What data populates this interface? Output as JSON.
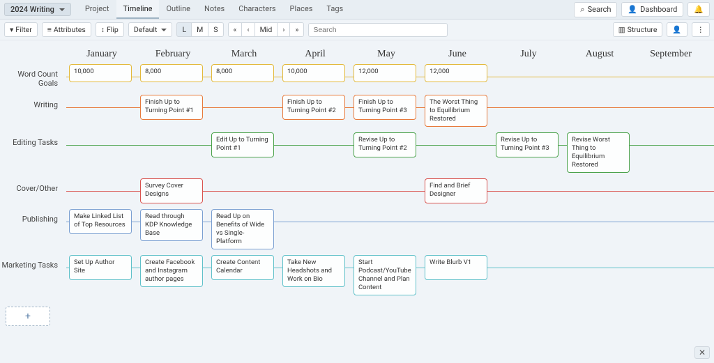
{
  "colors": {
    "gold": "#e2b93b",
    "orange": "#e77a3c",
    "green": "#4aa24a",
    "red": "#d9534f",
    "blue": "#7a9fd1",
    "teal": "#5fc0c9"
  },
  "project_name": "2024 Writing",
  "nav": {
    "tabs": [
      {
        "label": "Project"
      },
      {
        "label": "Timeline",
        "active": true
      },
      {
        "label": "Outline"
      },
      {
        "label": "Notes"
      },
      {
        "label": "Characters"
      },
      {
        "label": "Places"
      },
      {
        "label": "Tags"
      }
    ],
    "search_btn": "Search",
    "dashboard_btn": "Dashboard"
  },
  "toolbar": {
    "filter": "Filter",
    "attributes": "Attributes",
    "flip": "Flip",
    "default": "Default",
    "size_L": "L",
    "size_M": "M",
    "size_S": "S",
    "mid_label": "Mid",
    "search_placeholder": "Search",
    "structure": "Structure"
  },
  "months": [
    "January",
    "February",
    "March",
    "April",
    "May",
    "June",
    "July",
    "August",
    "September"
  ],
  "rows": [
    {
      "label": "Word Count Goals",
      "color": "gold",
      "thin": true,
      "cards": [
        {
          "col": 0,
          "text": "10,000"
        },
        {
          "col": 1,
          "text": "8,000"
        },
        {
          "col": 2,
          "text": "8,000"
        },
        {
          "col": 3,
          "text": "10,000"
        },
        {
          "col": 4,
          "text": "12,000"
        },
        {
          "col": 5,
          "text": "12,000"
        }
      ]
    },
    {
      "label": "Writing",
      "color": "orange",
      "cards": [
        {
          "col": 1,
          "text": "Finish Up to Turning Point #1"
        },
        {
          "col": 3,
          "text": "Finish Up to Turning Point #2"
        },
        {
          "col": 4,
          "text": "Finish Up to Turning Point #3"
        },
        {
          "col": 5,
          "text": "The Worst Thing to Equilibrium Restored"
        }
      ]
    },
    {
      "label": "Editing Tasks",
      "color": "green",
      "cards": [
        {
          "col": 2,
          "text": "Edit Up to Turning Point #1"
        },
        {
          "col": 4,
          "text": "Revise Up to Turning Point #2"
        },
        {
          "col": 6,
          "text": "Revise Up to Turning Point #3"
        },
        {
          "col": 7,
          "text": "Revise Worst Thing to Equilibrium Restored"
        }
      ]
    },
    {
      "label": "Cover/Other",
      "color": "red",
      "cards": [
        {
          "col": 1,
          "text": "Survey Cover Designs"
        },
        {
          "col": 5,
          "text": "Find and Brief Designer"
        }
      ]
    },
    {
      "label": "Publishing",
      "color": "blue",
      "cards": [
        {
          "col": 0,
          "text": "Make Linked List of Top Resources"
        },
        {
          "col": 1,
          "text": "Read through KDP Knowledge Base"
        },
        {
          "col": 2,
          "text": "Read Up on Benefits of Wide vs Single-Platform"
        }
      ]
    },
    {
      "label": "Marketing Tasks",
      "color": "teal",
      "cards": [
        {
          "col": 0,
          "text": "Set Up Author Site"
        },
        {
          "col": 1,
          "text": "Create Facebook and Instagram author pages"
        },
        {
          "col": 2,
          "text": "Create Content Calendar"
        },
        {
          "col": 3,
          "text": "Take New Headshots and Work on Bio"
        },
        {
          "col": 4,
          "text": "Start Podcast/YouTube Channel and Plan Content"
        },
        {
          "col": 5,
          "text": "Write Blurb V1"
        }
      ]
    }
  ],
  "add_row_label": "+"
}
